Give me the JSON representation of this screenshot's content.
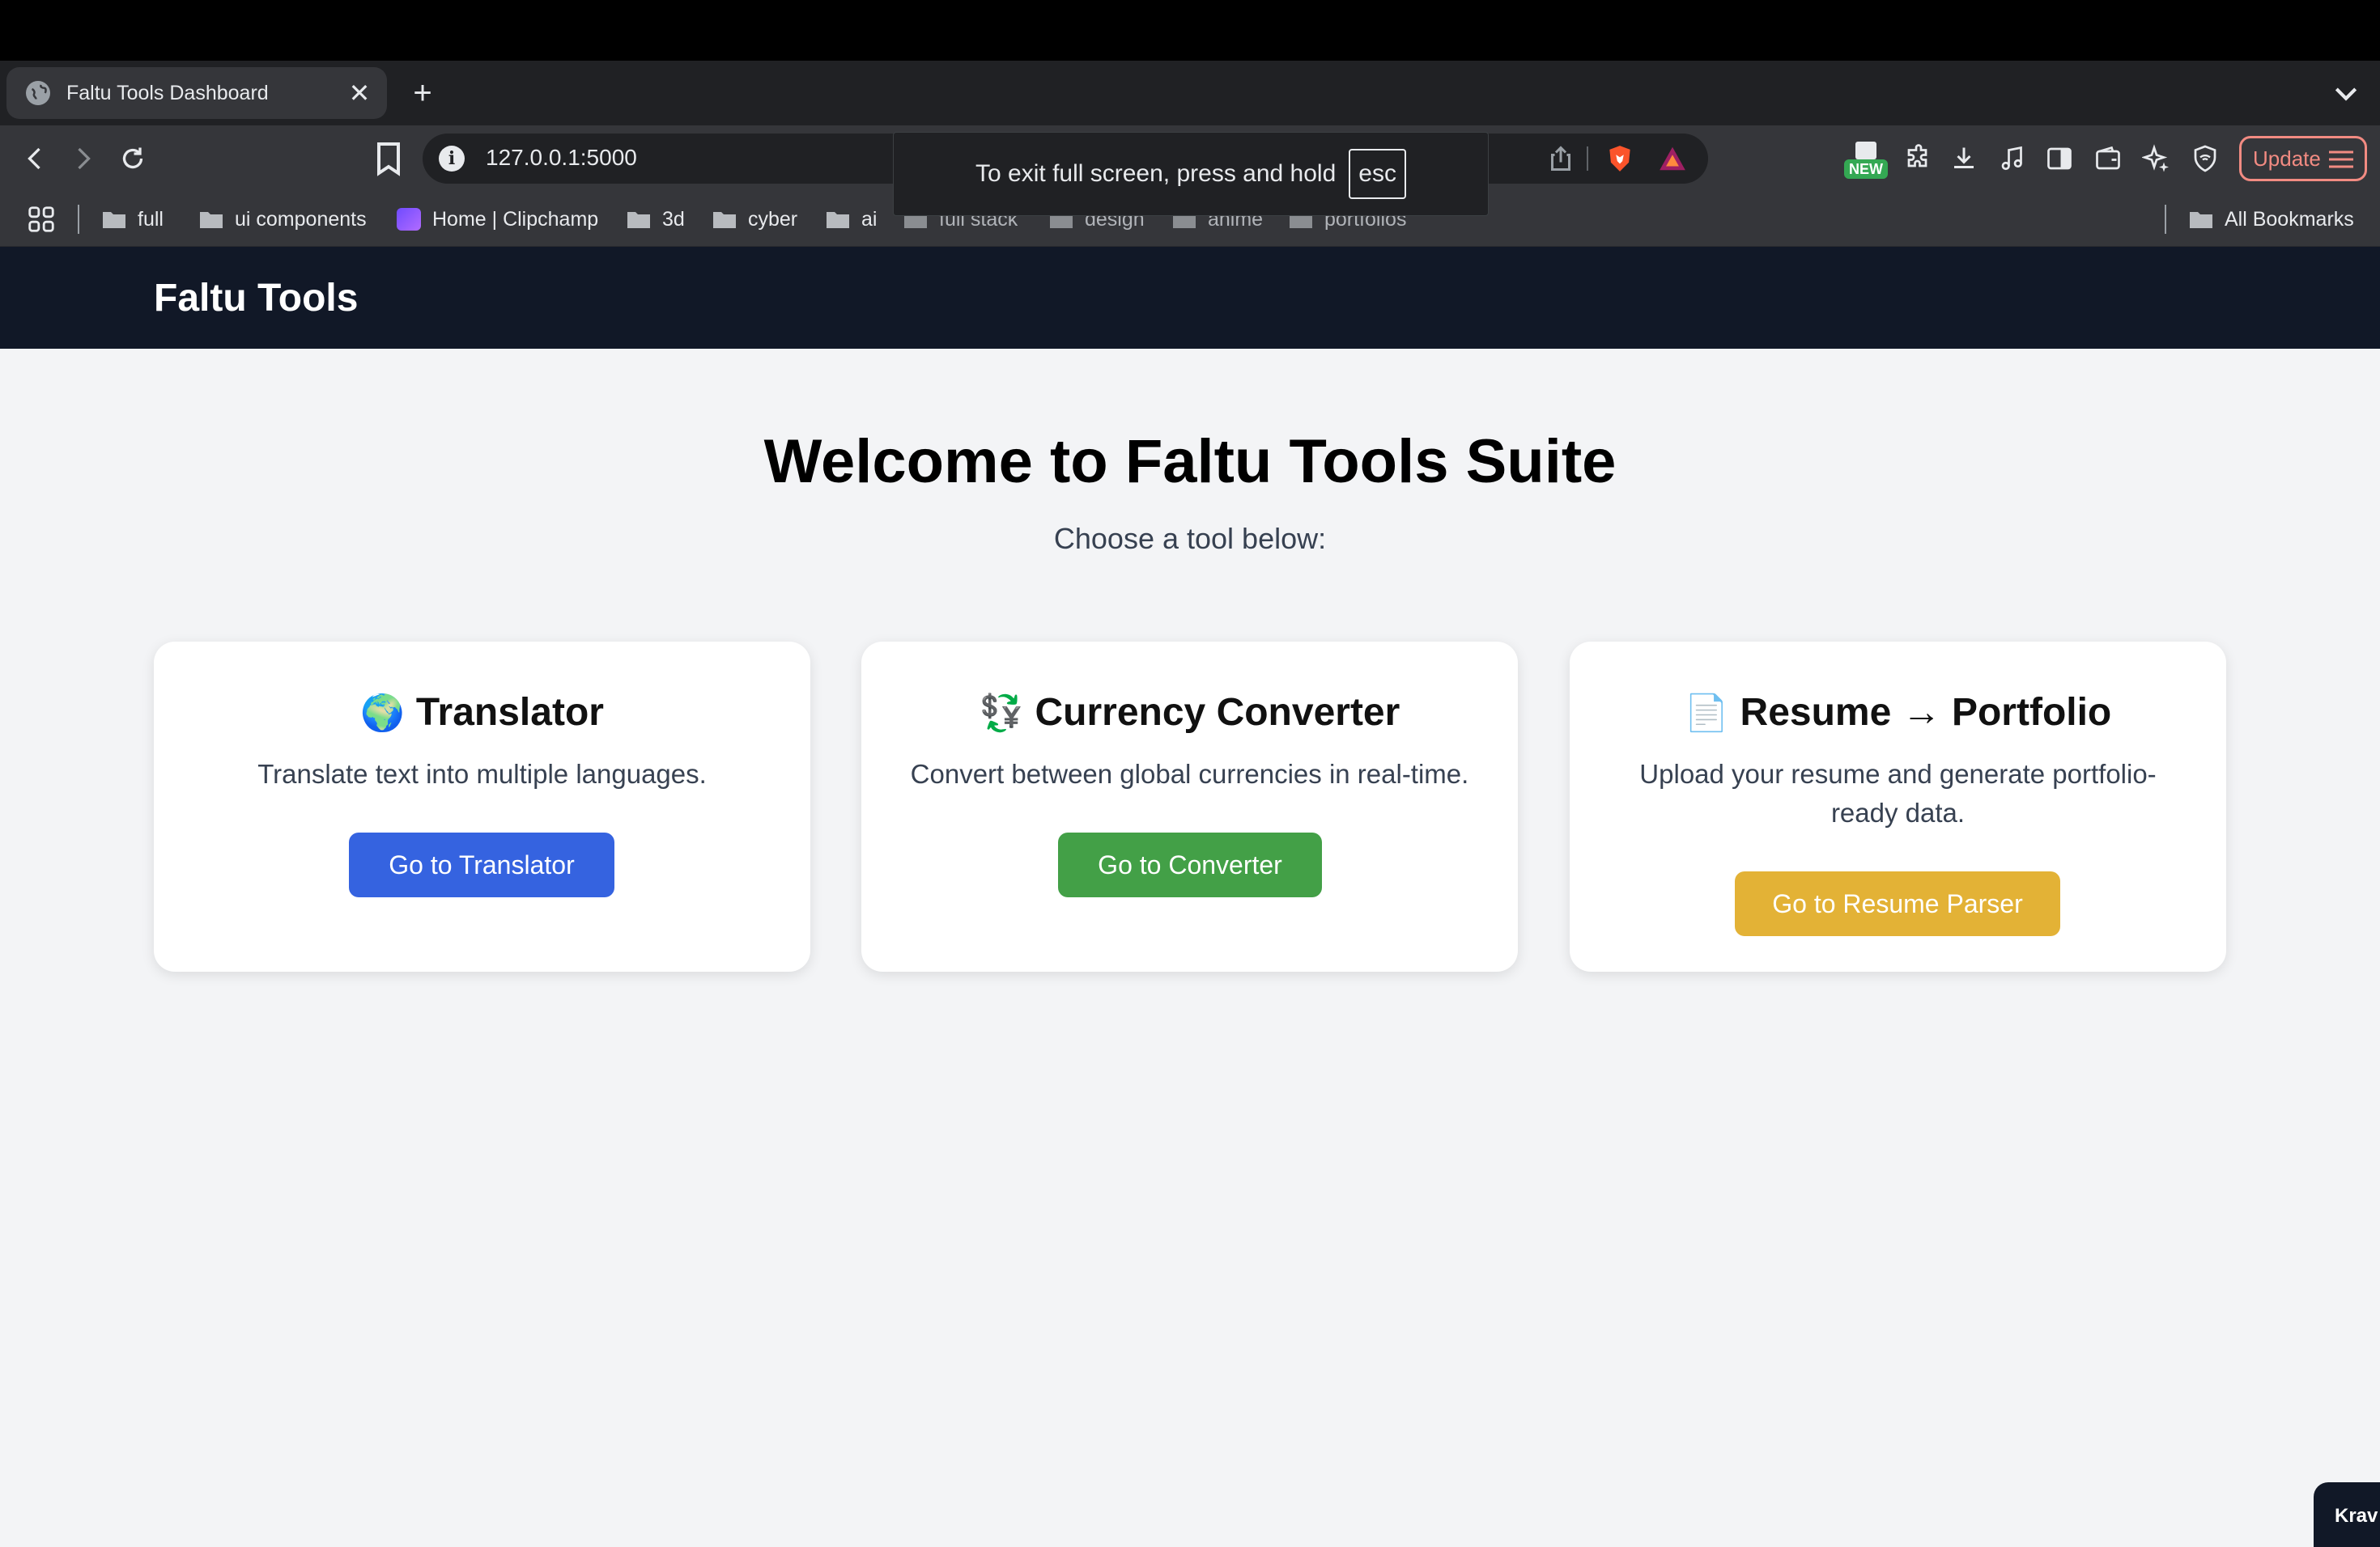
{
  "browser": {
    "tab": {
      "title": "Faltu Tools Dashboard"
    },
    "url": "127.0.0.1:5000",
    "fullscreen_toast": {
      "message": "To exit full screen, press and hold",
      "key": "esc"
    },
    "new_badge": "NEW",
    "update_label": "Update",
    "bookmarks": [
      "full",
      "ui components",
      "Home | Clipchamp",
      "3d",
      "cyber",
      "ai",
      "full stack",
      "design",
      "anime",
      "portfolios"
    ],
    "all_bookmarks_label": "All Bookmarks"
  },
  "app": {
    "brand": "Faltu Tools",
    "hero_title": "Welcome to Faltu Tools Suite",
    "hero_subtitle": "Choose a tool below:",
    "cards": [
      {
        "emoji": "🌍",
        "title": "Translator",
        "description": "Translate text into multiple languages.",
        "button_label": "Go to Translator",
        "button_color": "#3563e0"
      },
      {
        "emoji": "💱",
        "title": "Currency Converter",
        "description": "Convert between global currencies in real-time.",
        "button_label": "Go to Converter",
        "button_color": "#43a047"
      },
      {
        "emoji": "📄",
        "title": "Resume → Portfolio",
        "description": "Upload your resume and generate portfolio-ready data.",
        "button_label": "Go to Resume Parser",
        "button_color": "#e3b236"
      }
    ],
    "corner_widget_label": "Krav"
  }
}
